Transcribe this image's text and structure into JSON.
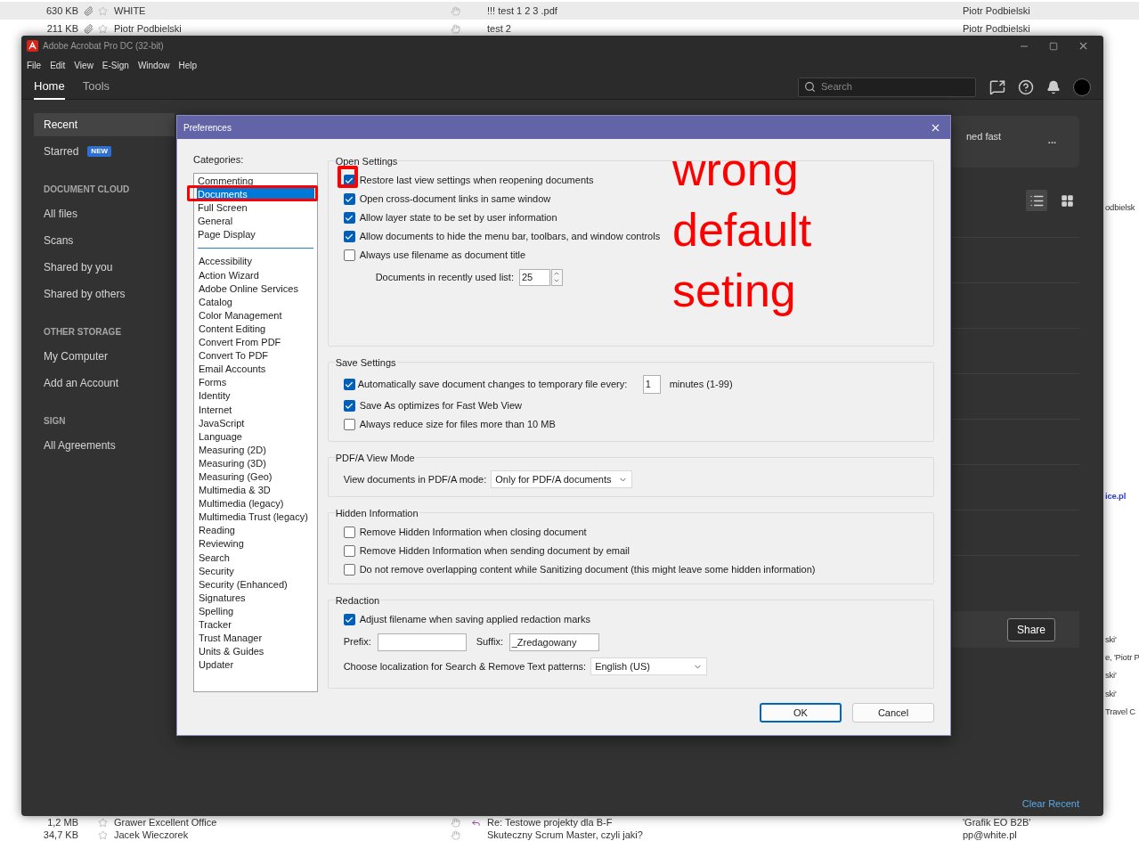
{
  "mail_list": {
    "top_rows": [
      {
        "size": "630 KB",
        "attachment": true,
        "sender": "WHITE",
        "subject": "!!! test 1 2 3 .pdf",
        "recipient": "Piotr Podbielski",
        "selected": true,
        "replied": false
      },
      {
        "size": "211 KB",
        "attachment": true,
        "sender": "Piotr Podbielski",
        "subject": "test 2",
        "recipient": "Piotr Podbielski",
        "selected": false,
        "replied": false
      }
    ],
    "edge_fragments": [
      {
        "kind": "text",
        "text": "odbielsk"
      },
      {
        "kind": "link",
        "text": "ice.pl"
      },
      {
        "kind": "text",
        "text": "ski'"
      },
      {
        "kind": "text",
        "text": "e, 'Piotr P"
      },
      {
        "kind": "text",
        "text": "ski'"
      },
      {
        "kind": "text",
        "text": "ski'"
      },
      {
        "kind": "text",
        "text": "Travel C"
      }
    ],
    "bottom_rows": [
      {
        "size": "1,2 MB",
        "attachment": false,
        "sender": "Grawer Excellent Office",
        "subject": "Re: Testowe projekty dla B-F",
        "recipient": "'Grafik EO B2B'",
        "selected": false,
        "replied": true
      },
      {
        "size": "34,7 KB",
        "attachment": false,
        "sender": "Jacek Wieczorek",
        "subject": "Skuteczny Scrum Master, czyli jaki?",
        "recipient": "pp@white.pl",
        "selected": false,
        "replied": false
      }
    ]
  },
  "window": {
    "title": "Adobe Acrobat Pro DC (32-bit)",
    "menu": [
      "File",
      "Edit",
      "View",
      "E-Sign",
      "Window",
      "Help"
    ],
    "tabs": [
      {
        "label": "Home",
        "selected": true
      },
      {
        "label": "Tools",
        "selected": false
      }
    ],
    "search": {
      "placeholder": "Search"
    },
    "sidebar": [
      {
        "kind": "item",
        "label": "Recent",
        "selected": true
      },
      {
        "kind": "item",
        "label": "Starred",
        "badge": "NEW",
        "selected": false
      },
      {
        "kind": "header",
        "label": "DOCUMENT CLOUD"
      },
      {
        "kind": "item",
        "label": "All files",
        "selected": false
      },
      {
        "kind": "item",
        "label": "Scans",
        "selected": false
      },
      {
        "kind": "item",
        "label": "Shared by you",
        "selected": false
      },
      {
        "kind": "item",
        "label": "Shared by others",
        "selected": false
      },
      {
        "kind": "header",
        "label": "OTHER STORAGE"
      },
      {
        "kind": "item",
        "label": "My Computer",
        "selected": false
      },
      {
        "kind": "item",
        "label": "Add an Account",
        "selected": false
      },
      {
        "kind": "header",
        "label": "SIGN"
      },
      {
        "kind": "item",
        "label": "All Agreements",
        "selected": false
      }
    ],
    "banner": {
      "text": "ned fast",
      "menu": "..."
    },
    "view_toggle": [
      {
        "kind": "list",
        "selected": true
      },
      {
        "kind": "grid",
        "selected": false
      }
    ],
    "share_button": "Share",
    "clear_recent": "Clear Recent"
  },
  "dialog": {
    "title": "Preferences",
    "categories_label": "Categories:",
    "category_groups": [
      [
        {
          "label": "Commenting",
          "selected": false
        },
        {
          "label": "Documents",
          "selected": true
        },
        {
          "label": "Full Screen",
          "selected": false
        },
        {
          "label": "General",
          "selected": false
        },
        {
          "label": "Page Display",
          "selected": false
        }
      ],
      [
        {
          "label": "Accessibility",
          "selected": false
        },
        {
          "label": "Action Wizard",
          "selected": false
        },
        {
          "label": "Adobe Online Services",
          "selected": false
        },
        {
          "label": "Catalog",
          "selected": false
        },
        {
          "label": "Color Management",
          "selected": false
        },
        {
          "label": "Content Editing",
          "selected": false
        },
        {
          "label": "Convert From PDF",
          "selected": false
        },
        {
          "label": "Convert To PDF",
          "selected": false
        },
        {
          "label": "Email Accounts",
          "selected": false
        },
        {
          "label": "Forms",
          "selected": false
        },
        {
          "label": "Identity",
          "selected": false
        },
        {
          "label": "Internet",
          "selected": false
        },
        {
          "label": "JavaScript",
          "selected": false
        },
        {
          "label": "Language",
          "selected": false
        },
        {
          "label": "Measuring (2D)",
          "selected": false
        },
        {
          "label": "Measuring (3D)",
          "selected": false
        },
        {
          "label": "Measuring (Geo)",
          "selected": false
        },
        {
          "label": "Multimedia & 3D",
          "selected": false
        },
        {
          "label": "Multimedia (legacy)",
          "selected": false
        },
        {
          "label": "Multimedia Trust (legacy)",
          "selected": false
        },
        {
          "label": "Reading",
          "selected": false
        },
        {
          "label": "Reviewing",
          "selected": false
        },
        {
          "label": "Search",
          "selected": false
        },
        {
          "label": "Security",
          "selected": false
        },
        {
          "label": "Security (Enhanced)",
          "selected": false
        },
        {
          "label": "Signatures",
          "selected": false
        },
        {
          "label": "Spelling",
          "selected": false
        },
        {
          "label": "Tracker",
          "selected": false
        },
        {
          "label": "Trust Manager",
          "selected": false
        },
        {
          "label": "Units & Guides",
          "selected": false
        },
        {
          "label": "Updater",
          "selected": false
        }
      ]
    ],
    "sections": [
      {
        "title": "Open Settings",
        "items": [
          {
            "kind": "checkbox",
            "label": "Restore last view settings when reopening documents",
            "checked": true
          },
          {
            "kind": "checkbox",
            "label": "Open cross-document links in same window",
            "checked": true
          },
          {
            "kind": "checkbox",
            "label": "Allow layer state to be set by user information",
            "checked": true
          },
          {
            "kind": "checkbox",
            "label": "Allow documents to hide the menu bar, toolbars, and window controls",
            "checked": true
          },
          {
            "kind": "checkbox",
            "label": "Always use filename as document title",
            "checked": false
          },
          {
            "kind": "spinner",
            "label": "Documents in recently used list:",
            "value": "25"
          }
        ]
      },
      {
        "title": "Save Settings",
        "items": [
          {
            "kind": "checkbox_field",
            "label": "Automatically save document changes to temporary file every:",
            "checked": true,
            "value": "1",
            "unit": "minutes (1-99)"
          },
          {
            "kind": "checkbox",
            "label": "Save As optimizes for Fast Web View",
            "checked": true
          },
          {
            "kind": "checkbox",
            "label": "Always reduce size for files more than 10 MB",
            "checked": false
          }
        ]
      },
      {
        "title": "PDF/A View Mode",
        "items": [
          {
            "kind": "select",
            "label": "View documents in PDF/A mode:",
            "value": "Only for PDF/A documents"
          }
        ]
      },
      {
        "title": "Hidden Information",
        "items": [
          {
            "kind": "checkbox",
            "label": "Remove Hidden Information when closing document",
            "checked": false
          },
          {
            "kind": "checkbox",
            "label": "Remove Hidden Information when sending document by email",
            "checked": false
          },
          {
            "kind": "checkbox",
            "label": "Do not remove overlapping content while Sanitizing document (this might leave some hidden information)",
            "checked": false
          }
        ]
      },
      {
        "title": "Redaction",
        "items": [
          {
            "kind": "checkbox",
            "label": "Adjust filename when saving applied redaction marks",
            "checked": true
          },
          {
            "kind": "affix_fields",
            "prefix_label": "Prefix:",
            "suffix_label": "Suffix:",
            "suffix_value": "_Zredagowany"
          },
          {
            "kind": "select",
            "label": "Choose localization for Search & Remove Text patterns:",
            "value": "English (US)"
          }
        ]
      }
    ],
    "buttons": [
      {
        "label": "OK",
        "default": true
      },
      {
        "label": "Cancel",
        "default": false
      }
    ]
  },
  "annotation": {
    "text": "wrong default seting"
  }
}
